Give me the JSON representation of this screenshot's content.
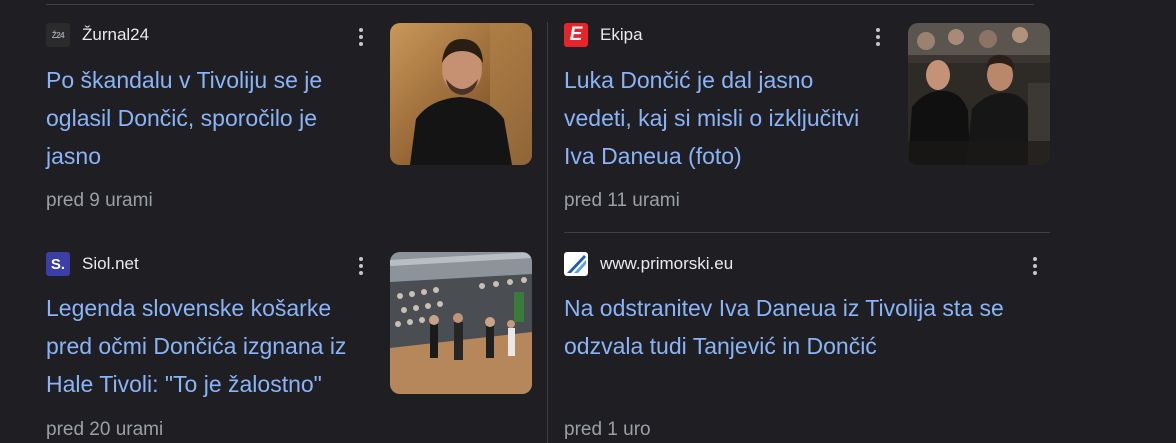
{
  "articles": [
    {
      "source": "Žurnal24",
      "favicon": "zurnal24-logo-icon",
      "favicon_text": "Ž24",
      "title": "Po škandalu v Tivoliju se je oglasil Dončić, sporočilo je jasno",
      "title_lines": [
        "Po škandalu v Tivoliju se je",
        "oglasil Dončić, sporočilo je",
        "jasno"
      ],
      "time": "pred 9 urami",
      "has_thumbnail": true
    },
    {
      "source": "Ekipa",
      "favicon": "ekipa-logo-icon",
      "favicon_text": "E",
      "title": "Luka Dončić je dal jasno vedeti, kaj si misli o izključitvi Iva Daneua (foto)",
      "title_lines": [
        "Luka Dončić je dal jasno",
        "vedeti, kaj si misli o izključitvi",
        "Iva Daneua (foto)"
      ],
      "time": "pred 11 urami",
      "has_thumbnail": true
    },
    {
      "source": "Siol.net",
      "favicon": "siol-logo-icon",
      "favicon_text": "S.",
      "title": "Legenda slovenske košarke pred očmi Dončića izgnana iz Hale Tivoli: \"To je žalostno\"",
      "title_lines": [
        "Legenda slovenske košarke",
        "pred očmi Dončića izgnana iz",
        "Hale Tivoli: \"To je žalostno\""
      ],
      "time": "pred 20 urami",
      "has_thumbnail": true
    },
    {
      "source": "www.primorski.eu",
      "favicon": "primorski-logo-icon",
      "favicon_text": "",
      "title": "Na odstranitev Iva Daneua iz Tivolija sta se odzvala tudi Tanjević in Dončić",
      "title_lines": [
        "Na odstranitev Iva Daneua iz Tivolija sta se",
        "odzvala tudi Tanjević in Dončić"
      ],
      "time": "pred 1 uro",
      "has_thumbnail": false
    }
  ],
  "colors": {
    "background": "#1f1f23",
    "link": "#8ab4f8",
    "muted": "#9aa0a6",
    "divider": "#3c4043"
  }
}
